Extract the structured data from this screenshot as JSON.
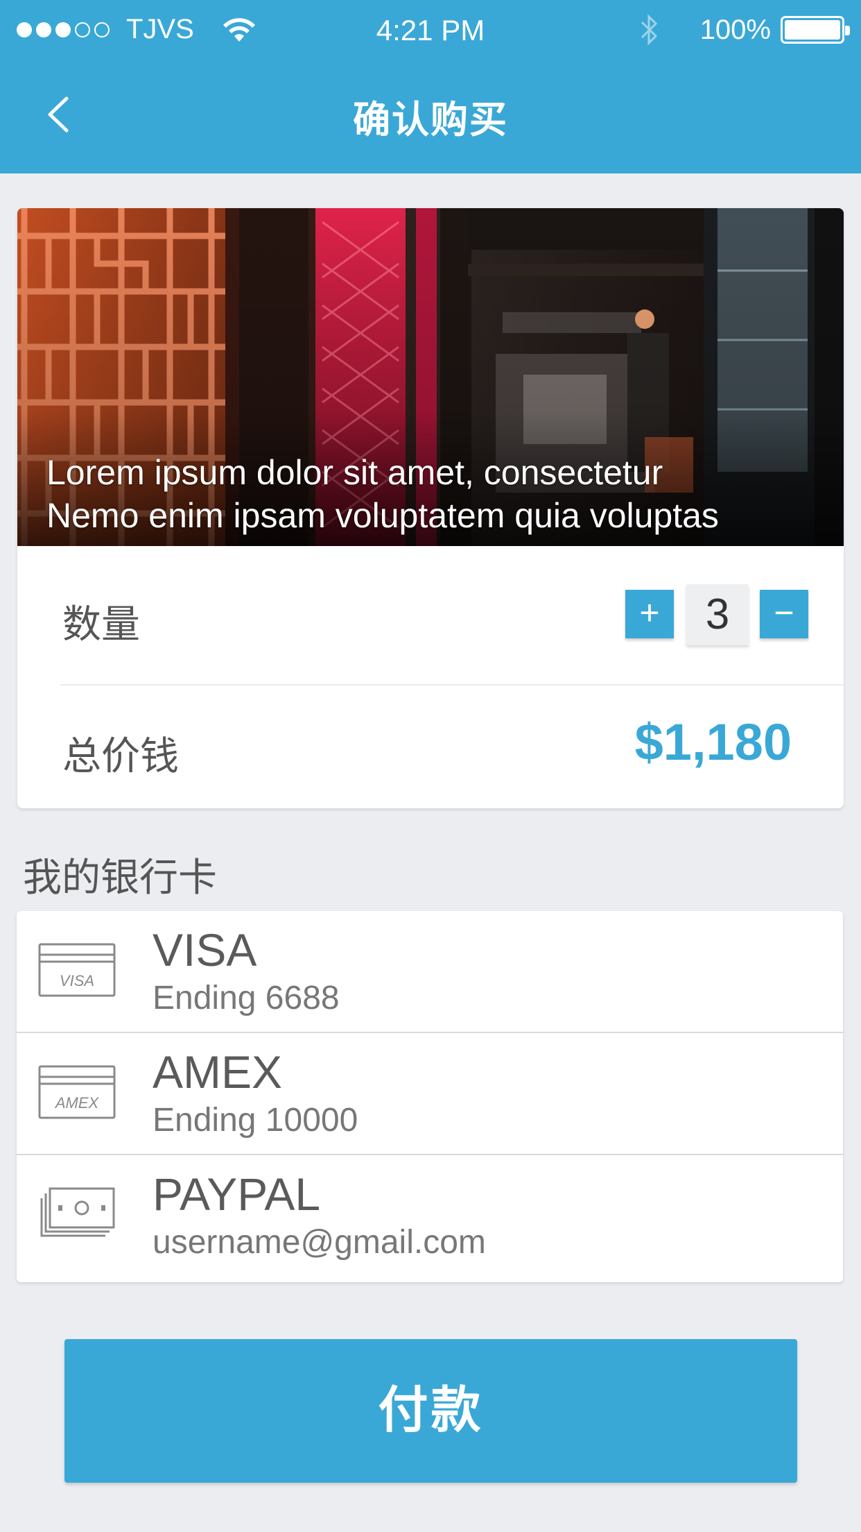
{
  "status_bar": {
    "carrier": "TJVS",
    "time": "4:21 PM",
    "battery": "100%",
    "signal_filled": 3,
    "signal_total": 5
  },
  "header": {
    "title": "确认购买",
    "background_color": "#3aa8d6"
  },
  "product": {
    "caption_line1": "Lorem ipsum dolor sit amet, consectetur",
    "caption_line2": "Nemo enim ipsam voluptatem quia voluptas",
    "quantity_label": "数量",
    "quantity_value": "3",
    "plus_label": "+",
    "minus_label": "−",
    "total_label": "总价钱",
    "total_price": "$1,180"
  },
  "bank_cards": {
    "section_title": "我的银行卡",
    "items": [
      {
        "name": "VISA",
        "detail": "Ending 6688",
        "icon": "visa-card-icon",
        "icon_text": "VISA"
      },
      {
        "name": "AMEX",
        "detail": "Ending 10000",
        "icon": "amex-card-icon",
        "icon_text": "AMEX"
      },
      {
        "name": "PAYPAL",
        "detail": "username@gmail.com",
        "icon": "money-bills-icon"
      }
    ]
  },
  "pay_button": {
    "label": "付款"
  },
  "colors": {
    "accent": "#3aa8d6",
    "background": "#ebedf0"
  }
}
